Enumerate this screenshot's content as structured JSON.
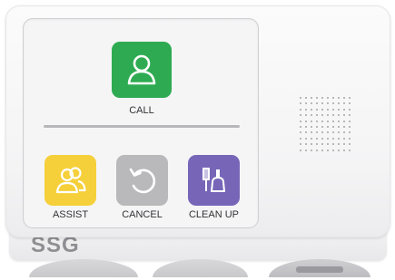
{
  "device": {
    "brand": "SSG",
    "buttons": [
      {
        "id": "call",
        "label": "CALL",
        "color": "#2eab52",
        "icon": "person-icon"
      },
      {
        "id": "assist",
        "label": "ASSIST",
        "color": "#f5d03a",
        "icon": "people-icon"
      },
      {
        "id": "cancel",
        "label": "CANCEL",
        "color": "#b9b9bc",
        "icon": "undo-icon"
      },
      {
        "id": "clean",
        "label": "CLEAN UP",
        "color": "#7766b8",
        "icon": "broom-dustpan-icon"
      }
    ]
  }
}
